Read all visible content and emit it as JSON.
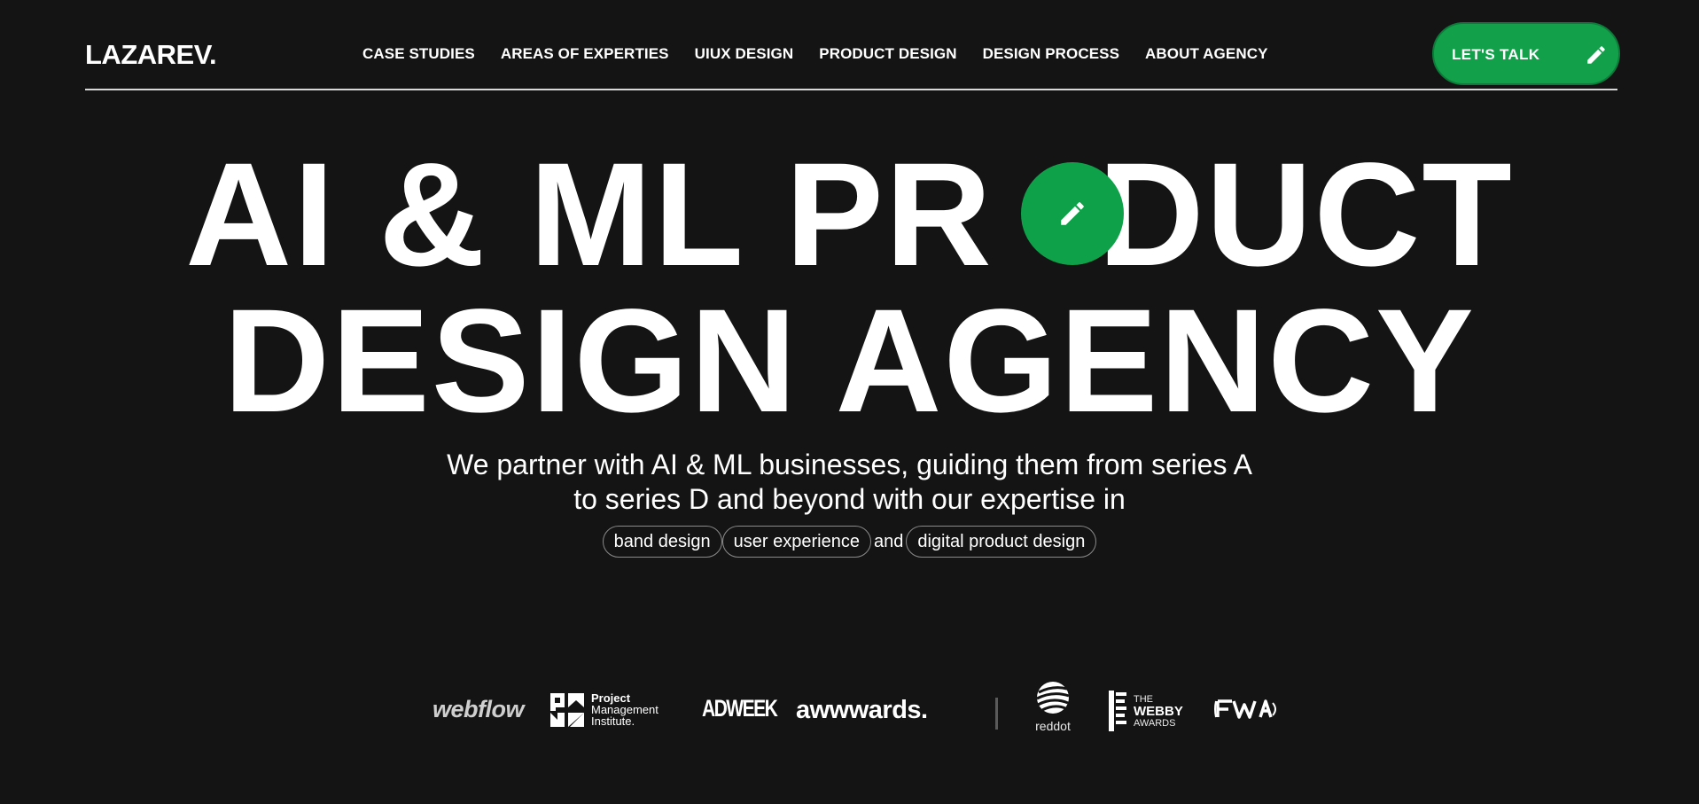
{
  "header": {
    "logo": "LAZAREV.",
    "nav": [
      {
        "label": "CASE STUDIES"
      },
      {
        "label": "AREAS OF EXPERTIES"
      },
      {
        "label": "UIUX DESIGN"
      },
      {
        "label": "PRODUCT DESIGN"
      },
      {
        "label": "DESIGN PROCESS"
      },
      {
        "label": "ABOUT AGENCY"
      }
    ],
    "cta": {
      "label": "LET'S TALK",
      "icon": "pencil-icon"
    }
  },
  "hero": {
    "line1": {
      "before": "AI & ML PR",
      "after": "DUCT"
    },
    "line2": "DESIGN AGENCY",
    "bubble_icon": "pencil-icon",
    "subtitle_line1": "We partner with AI & ML businesses, guiding them from series A",
    "subtitle_line2": "to series D and beyond with our expertise in",
    "tags": [
      "band design",
      "user experience",
      "digital product design"
    ],
    "tag_connector": "and"
  },
  "logos": {
    "webflow": "webflow",
    "pmi": {
      "line1": "Project",
      "line2": "Management",
      "line3": "Institute."
    },
    "adweek": "ADWEEK",
    "awwwards": "awwwards.",
    "reddot": "reddot",
    "webby": {
      "line1": "THE",
      "line2": "WEBBY",
      "line3": "AWARDS"
    },
    "fwa": "FWA"
  },
  "colors": {
    "background": "#141414",
    "accent": "#12a14a",
    "text": "#ffffff"
  }
}
